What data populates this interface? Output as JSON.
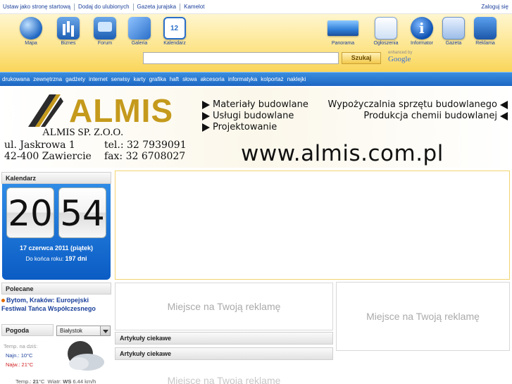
{
  "toplinks": {
    "items": [
      "Ustaw jako stronę startową",
      "Dodaj do ulubionych",
      "Gazeta jurajska",
      "Kamelot"
    ],
    "login": "Zaloguj się"
  },
  "icons_left": [
    {
      "label": "Mapa",
      "icon": "map-icon"
    },
    {
      "label": "Biznes",
      "icon": "business-icon"
    },
    {
      "label": "Forum",
      "icon": "forum-icon"
    },
    {
      "label": "Galeria",
      "icon": "gallery-icon"
    },
    {
      "label": "Kalendarz",
      "icon": "calendar-icon"
    }
  ],
  "icons_right": [
    {
      "label": "Panorama",
      "icon": "panorama-icon"
    },
    {
      "label": "Ogłoszenia",
      "icon": "ads-icon"
    },
    {
      "label": "Informator",
      "icon": "info-icon"
    },
    {
      "label": "Gazeta",
      "icon": "newspaper-icon"
    },
    {
      "label": "Reklama",
      "icon": "advertising-icon"
    }
  ],
  "search": {
    "value": "",
    "button": "Szukaj",
    "enhanced": "enhanced by",
    "google": "Google"
  },
  "categories": [
    "drukowana",
    "zewnętrzna",
    "gadżety",
    "internet",
    "serwisy",
    "karty",
    "grafika",
    "haft",
    "słowa",
    "akcesoria",
    "informatyka",
    "kolportaż",
    "naklejki"
  ],
  "banner": {
    "logo": "ALMIS",
    "company": "ALMIS SP. Z.O.O.",
    "street": "ul. Jaskrowa 1",
    "city": "42-400 Zawiercie",
    "tel": "tel.: 32 7939091",
    "fax": "fax: 32 6708027",
    "services_left": [
      "Materiały budowlane",
      "Usługi budowlane",
      "Projektowanie"
    ],
    "services_right": [
      "Wypożyczalnia sprzętu budowlanego",
      "Produkcja chemii budowlanej"
    ],
    "url": "www.almis.com.pl",
    "brand_color": "#c59a1c"
  },
  "calendar": {
    "title": "Kalendarz",
    "hour": "20",
    "minute": "54",
    "date": "17 czerwca 2011 (piątek)",
    "remaining_label": "Do końca roku:",
    "remaining_value": "197 dni"
  },
  "polecane": {
    "title": "Polecane",
    "item": "Bytom, Kraków: Europejski Festiwal Tańca Współczesnego"
  },
  "weather": {
    "title": "Pogoda",
    "city": "Białystok",
    "today_label": "Temp. na dziś:",
    "max_label": "Najn.:",
    "max_value": "10",
    "min_label": "Najw.:",
    "min_value": "21",
    "unit": "°C",
    "temp_label": "Temp.:",
    "temp_value": "21",
    "wind_label": "Wiatr:",
    "wind_value": "WS",
    "wind_speed": "6.44 km/h"
  },
  "ads": {
    "placeholder": "Miejsce na Twoją reklamę"
  },
  "articles": [
    "Artykuły ciekawe",
    "Artykuły ciekawe"
  ]
}
